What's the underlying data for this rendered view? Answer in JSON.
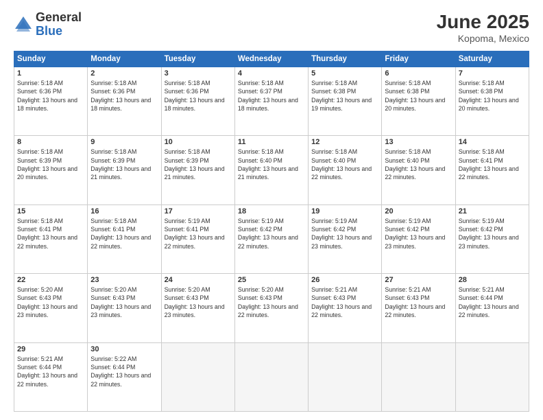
{
  "logo": {
    "general": "General",
    "blue": "Blue"
  },
  "title": "June 2025",
  "location": "Kopoma, Mexico",
  "days_header": [
    "Sunday",
    "Monday",
    "Tuesday",
    "Wednesday",
    "Thursday",
    "Friday",
    "Saturday"
  ],
  "weeks": [
    [
      {
        "day": "1",
        "sunrise": "5:18 AM",
        "sunset": "6:36 PM",
        "daylight": "13 hours and 18 minutes."
      },
      {
        "day": "2",
        "sunrise": "5:18 AM",
        "sunset": "6:36 PM",
        "daylight": "13 hours and 18 minutes."
      },
      {
        "day": "3",
        "sunrise": "5:18 AM",
        "sunset": "6:36 PM",
        "daylight": "13 hours and 18 minutes."
      },
      {
        "day": "4",
        "sunrise": "5:18 AM",
        "sunset": "6:37 PM",
        "daylight": "13 hours and 18 minutes."
      },
      {
        "day": "5",
        "sunrise": "5:18 AM",
        "sunset": "6:38 PM",
        "daylight": "13 hours and 19 minutes."
      },
      {
        "day": "6",
        "sunrise": "5:18 AM",
        "sunset": "6:38 PM",
        "daylight": "13 hours and 20 minutes."
      },
      {
        "day": "7",
        "sunrise": "5:18 AM",
        "sunset": "6:38 PM",
        "daylight": "13 hours and 20 minutes."
      }
    ],
    [
      {
        "day": "8",
        "sunrise": "5:18 AM",
        "sunset": "6:39 PM",
        "daylight": "13 hours and 20 minutes."
      },
      {
        "day": "9",
        "sunrise": "5:18 AM",
        "sunset": "6:39 PM",
        "daylight": "13 hours and 21 minutes."
      },
      {
        "day": "10",
        "sunrise": "5:18 AM",
        "sunset": "6:39 PM",
        "daylight": "13 hours and 21 minutes."
      },
      {
        "day": "11",
        "sunrise": "5:18 AM",
        "sunset": "6:40 PM",
        "daylight": "13 hours and 21 minutes."
      },
      {
        "day": "12",
        "sunrise": "5:18 AM",
        "sunset": "6:40 PM",
        "daylight": "13 hours and 22 minutes."
      },
      {
        "day": "13",
        "sunrise": "5:18 AM",
        "sunset": "6:40 PM",
        "daylight": "13 hours and 22 minutes."
      },
      {
        "day": "14",
        "sunrise": "5:18 AM",
        "sunset": "6:41 PM",
        "daylight": "13 hours and 22 minutes."
      }
    ],
    [
      {
        "day": "15",
        "sunrise": "5:18 AM",
        "sunset": "6:41 PM",
        "daylight": "13 hours and 22 minutes."
      },
      {
        "day": "16",
        "sunrise": "5:18 AM",
        "sunset": "6:41 PM",
        "daylight": "13 hours and 22 minutes."
      },
      {
        "day": "17",
        "sunrise": "5:19 AM",
        "sunset": "6:41 PM",
        "daylight": "13 hours and 22 minutes."
      },
      {
        "day": "18",
        "sunrise": "5:19 AM",
        "sunset": "6:42 PM",
        "daylight": "13 hours and 22 minutes."
      },
      {
        "day": "19",
        "sunrise": "5:19 AM",
        "sunset": "6:42 PM",
        "daylight": "13 hours and 23 minutes."
      },
      {
        "day": "20",
        "sunrise": "5:19 AM",
        "sunset": "6:42 PM",
        "daylight": "13 hours and 23 minutes."
      },
      {
        "day": "21",
        "sunrise": "5:19 AM",
        "sunset": "6:42 PM",
        "daylight": "13 hours and 23 minutes."
      }
    ],
    [
      {
        "day": "22",
        "sunrise": "5:20 AM",
        "sunset": "6:43 PM",
        "daylight": "13 hours and 23 minutes."
      },
      {
        "day": "23",
        "sunrise": "5:20 AM",
        "sunset": "6:43 PM",
        "daylight": "13 hours and 23 minutes."
      },
      {
        "day": "24",
        "sunrise": "5:20 AM",
        "sunset": "6:43 PM",
        "daylight": "13 hours and 23 minutes."
      },
      {
        "day": "25",
        "sunrise": "5:20 AM",
        "sunset": "6:43 PM",
        "daylight": "13 hours and 22 minutes."
      },
      {
        "day": "26",
        "sunrise": "5:21 AM",
        "sunset": "6:43 PM",
        "daylight": "13 hours and 22 minutes."
      },
      {
        "day": "27",
        "sunrise": "5:21 AM",
        "sunset": "6:43 PM",
        "daylight": "13 hours and 22 minutes."
      },
      {
        "day": "28",
        "sunrise": "5:21 AM",
        "sunset": "6:44 PM",
        "daylight": "13 hours and 22 minutes."
      }
    ],
    [
      {
        "day": "29",
        "sunrise": "5:21 AM",
        "sunset": "6:44 PM",
        "daylight": "13 hours and 22 minutes."
      },
      {
        "day": "30",
        "sunrise": "5:22 AM",
        "sunset": "6:44 PM",
        "daylight": "13 hours and 22 minutes."
      },
      null,
      null,
      null,
      null,
      null
    ]
  ]
}
